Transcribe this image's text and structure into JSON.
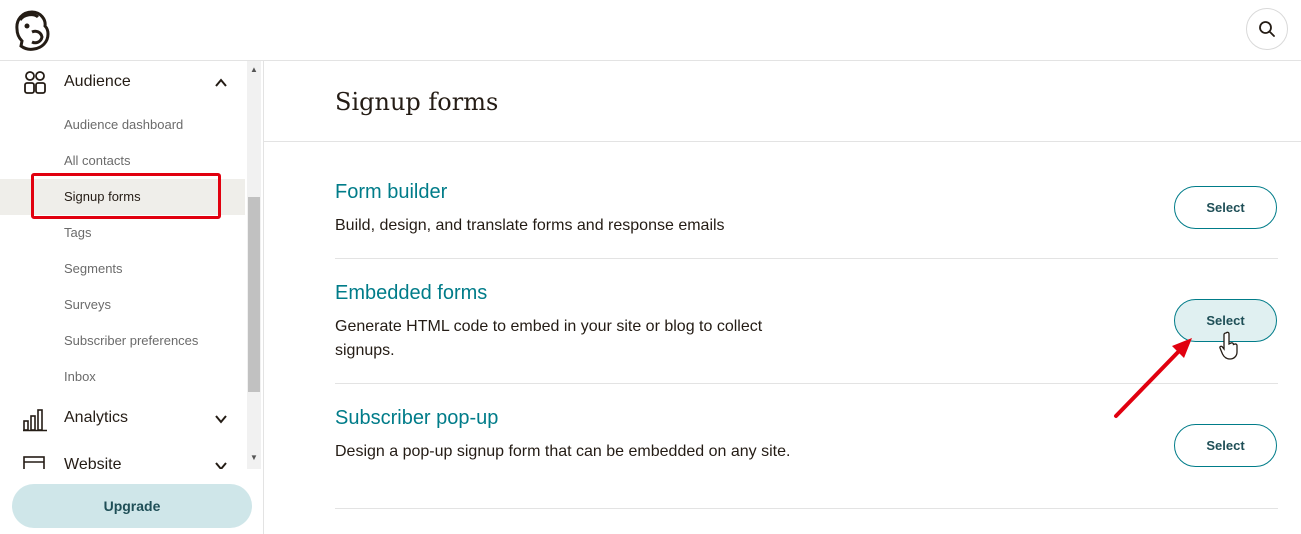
{
  "header": {
    "logo": "mailchimp-freddie-logo",
    "search_icon": "search-icon"
  },
  "sidebar": {
    "sections": [
      {
        "label": "Audience",
        "icon": "audience-icon",
        "expanded": true
      },
      {
        "label": "Analytics",
        "icon": "analytics-icon",
        "expanded": false
      },
      {
        "label": "Website",
        "icon": "website-icon",
        "expanded": false
      }
    ],
    "audience_items": [
      {
        "label": "Audience dashboard"
      },
      {
        "label": "All contacts"
      },
      {
        "label": "Signup forms",
        "active": true
      },
      {
        "label": "Tags"
      },
      {
        "label": "Segments"
      },
      {
        "label": "Surveys"
      },
      {
        "label": "Subscriber preferences"
      },
      {
        "label": "Inbox"
      }
    ],
    "upgrade_label": "Upgrade"
  },
  "main": {
    "title": "Signup forms",
    "options": [
      {
        "title": "Form builder",
        "description": "Build, design, and translate forms and response emails",
        "button": "Select"
      },
      {
        "title": "Embedded forms",
        "description": "Generate HTML code to embed in your site or blog to collect signups.",
        "button": "Select"
      },
      {
        "title": "Subscriber pop-up",
        "description": "Design a pop-up signup form that can be embedded on any site.",
        "button": "Select"
      }
    ]
  },
  "colors": {
    "accent": "#007c89",
    "highlight": "#e1000f",
    "upgrade_bg": "#cfe6e9",
    "active_bg": "#efeeea"
  }
}
